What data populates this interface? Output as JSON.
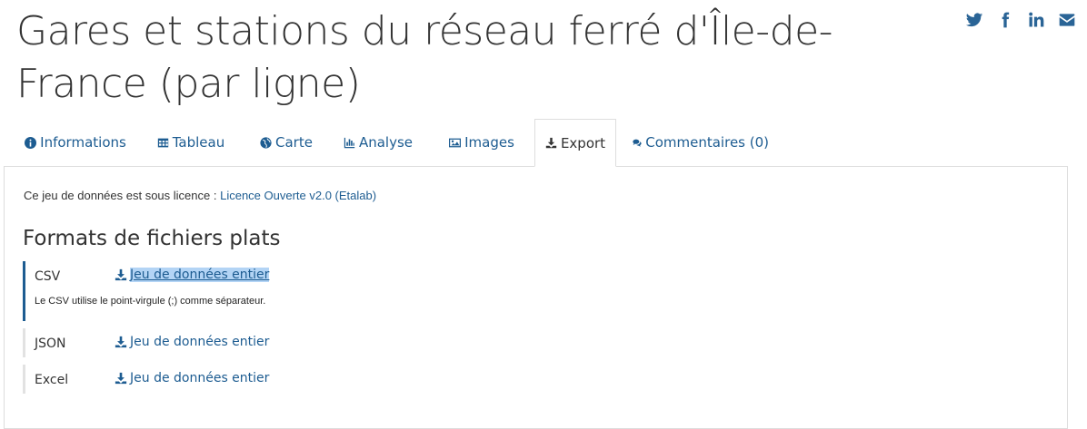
{
  "page": {
    "title": "Gares et stations du réseau ferré d'Île-de-France (par ligne)"
  },
  "social": [
    {
      "icon": "twitter-icon"
    },
    {
      "icon": "facebook-icon"
    },
    {
      "icon": "linkedin-icon"
    },
    {
      "icon": "email-icon"
    }
  ],
  "tabs": [
    {
      "label": "Informations",
      "icon": "info-circle-icon",
      "active": false
    },
    {
      "label": "Tableau",
      "icon": "table-icon",
      "active": false
    },
    {
      "label": "Carte",
      "icon": "globe-icon",
      "active": false
    },
    {
      "label": "Analyse",
      "icon": "bar-chart-icon",
      "active": false
    },
    {
      "label": "Images",
      "icon": "image-icon",
      "active": false
    },
    {
      "label": "Export",
      "icon": "download-icon",
      "active": true
    },
    {
      "label": "Commentaires (0)",
      "icon": "comments-icon",
      "active": false
    }
  ],
  "export": {
    "licence_prefix": "Ce jeu de données est sous licence :",
    "licence_link": "Licence Ouverte v2.0 (Etalab)",
    "section_title": "Formats de fichiers plats",
    "formats": [
      {
        "name": "CSV",
        "link": "Jeu de données entier",
        "note": "Le CSV utilise le point-virgule (;) comme séparateur.",
        "selected": true
      },
      {
        "name": "JSON",
        "link": "Jeu de données entier"
      },
      {
        "name": "Excel",
        "link": "Jeu de données entier"
      }
    ]
  },
  "colors": {
    "link": "#1d5c91",
    "selection": "#b3d4f5",
    "active_border": "#1d5c91"
  }
}
